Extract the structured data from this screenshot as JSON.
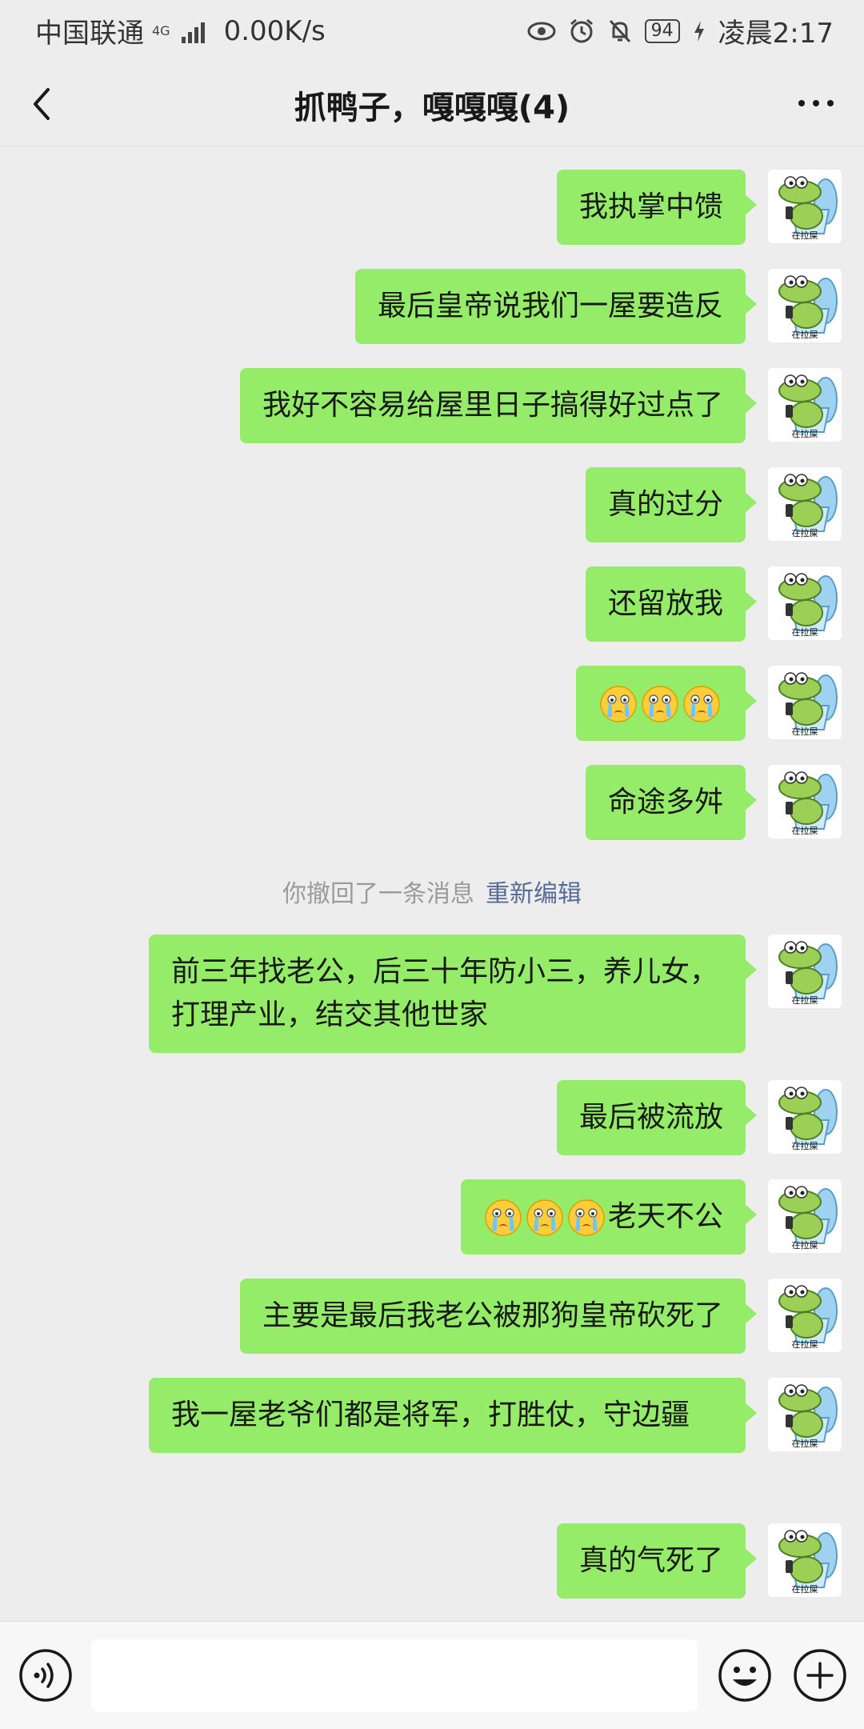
{
  "status_bar": {
    "carrier": "中国联通",
    "network": "4G",
    "speed": "0.00K/s",
    "battery": "94",
    "time": "凌晨2:17"
  },
  "header": {
    "title": "抓鸭子，嘎嘎嘎(4)"
  },
  "avatar_caption": "在拉屎",
  "messages": [
    {
      "text": "我执掌中馈"
    },
    {
      "text": "最后皇帝说我们一屋要造反"
    },
    {
      "text": "我好不容易给屋里日子搞得好过点了"
    },
    {
      "text": "真的过分"
    },
    {
      "text": "还留放我"
    },
    {
      "text": "",
      "emoji_count": 3
    },
    {
      "text": "命途多舛"
    },
    {
      "text": "前三年找老公，后三十年防小三，养儿女，打理产业，结交其他世家"
    },
    {
      "text": "最后被流放"
    },
    {
      "text": "老天不公",
      "emoji_count": 3
    },
    {
      "text": "主要是最后我老公被那狗皇帝砍死了"
    },
    {
      "text": "我一屋老爷们都是将军，打胜仗，守边疆"
    },
    {
      "text": "真的气死了"
    }
  ],
  "system_note": {
    "text": "你撤回了一条消息",
    "action": "重新编辑"
  },
  "colors": {
    "bubble": "#95ec69",
    "background": "#ededed",
    "link": "#576b95"
  },
  "icons": [
    "back-icon",
    "more-icon",
    "voice-icon",
    "emoji-icon",
    "plus-icon",
    "crying-emoji-icon",
    "eye-icon",
    "alarm-icon",
    "mute-icon"
  ]
}
